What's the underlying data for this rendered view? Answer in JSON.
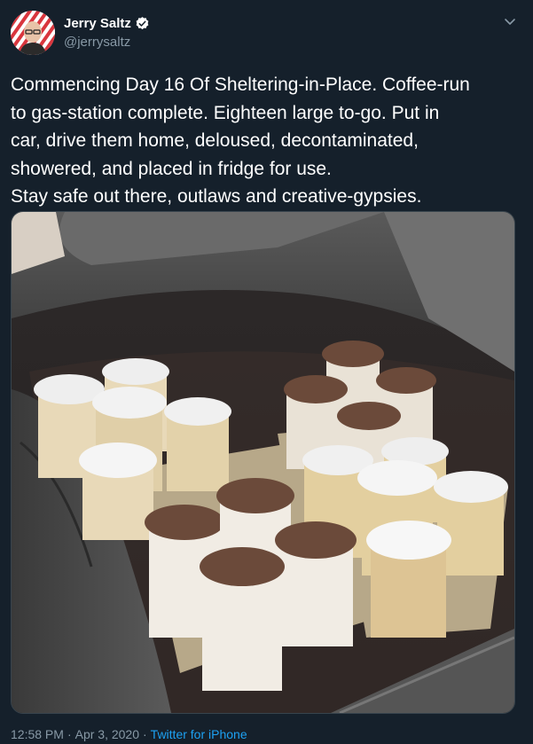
{
  "user": {
    "display_name": "Jerry Saltz",
    "handle": "@jerrysaltz",
    "verified": true
  },
  "icons": {
    "verified": "verified-badge-icon",
    "menu": "chevron-down-icon"
  },
  "tweet": {
    "text": "Commencing Day 16 Of Sheltering-in-Place. Coffee-run\nto gas-station complete. Eighteen large to-go.  Put in\ncar, drive them home, deloused, decontaminated,\nshowered, and placed in fridge for use.\nStay safe out there, outlaws and creative-gypsies.",
    "time": "12:58 PM",
    "date": "Apr 3, 2020",
    "source": "Twitter for iPhone",
    "separator": "·"
  },
  "colors": {
    "background": "#15202b",
    "secondary_text": "#8899a6",
    "link": "#1da1f2"
  }
}
